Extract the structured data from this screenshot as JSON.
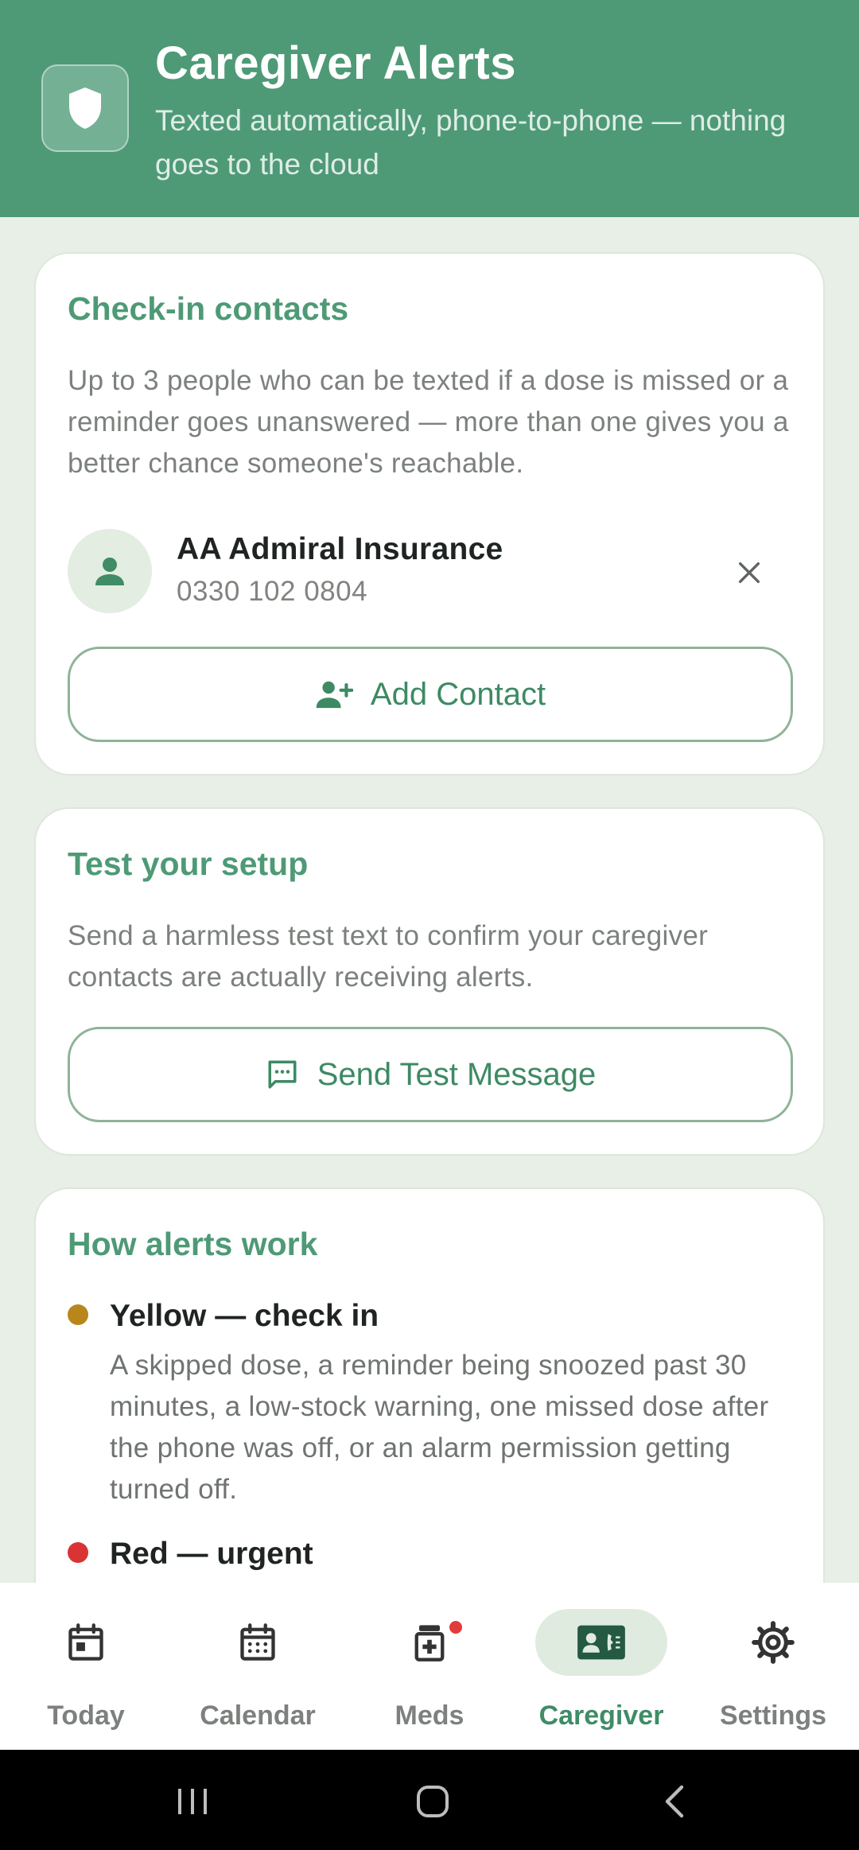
{
  "header": {
    "title": "Caregiver Alerts",
    "subtitle": "Texted automatically, phone-to-phone — nothing goes to the cloud",
    "icon": "shield-icon"
  },
  "contacts_card": {
    "title": "Check-in contacts",
    "description": "Up to 3 people who can be texted if a dose is missed or a reminder goes unanswered — more than one gives you a better chance someone's reachable.",
    "contacts": [
      {
        "name": "AA Admiral Insurance",
        "phone": "0330 102 0804"
      }
    ],
    "add_button_label": "Add Contact"
  },
  "test_card": {
    "title": "Test your setup",
    "description": "Send a harmless test text to confirm your caregiver contacts are actually receiving alerts.",
    "button_label": "Send Test Message"
  },
  "alerts_card": {
    "title": "How alerts work",
    "levels": [
      {
        "title": "Yellow — check in",
        "description": "A skipped dose, a reminder being snoozed past 30 minutes, a low-stock warning, one missed dose after the phone was off, or an alarm permission getting turned off.",
        "color": "#b8861b"
      },
      {
        "title": "Red — urgent",
        "description": "",
        "color": "#d93333"
      }
    ]
  },
  "bottom_nav": {
    "items": [
      {
        "label": "Today",
        "icon": "calendar-today-icon",
        "active": false
      },
      {
        "label": "Calendar",
        "icon": "calendar-month-icon",
        "active": false
      },
      {
        "label": "Meds",
        "icon": "medication-icon",
        "active": false,
        "badge": true
      },
      {
        "label": "Caregiver",
        "icon": "contact-phone-icon",
        "active": true
      },
      {
        "label": "Settings",
        "icon": "gear-icon",
        "active": false
      }
    ]
  },
  "colors": {
    "primary": "#4e9a76",
    "background": "#e8efe6",
    "yellow": "#b8861b",
    "red": "#d93333"
  }
}
